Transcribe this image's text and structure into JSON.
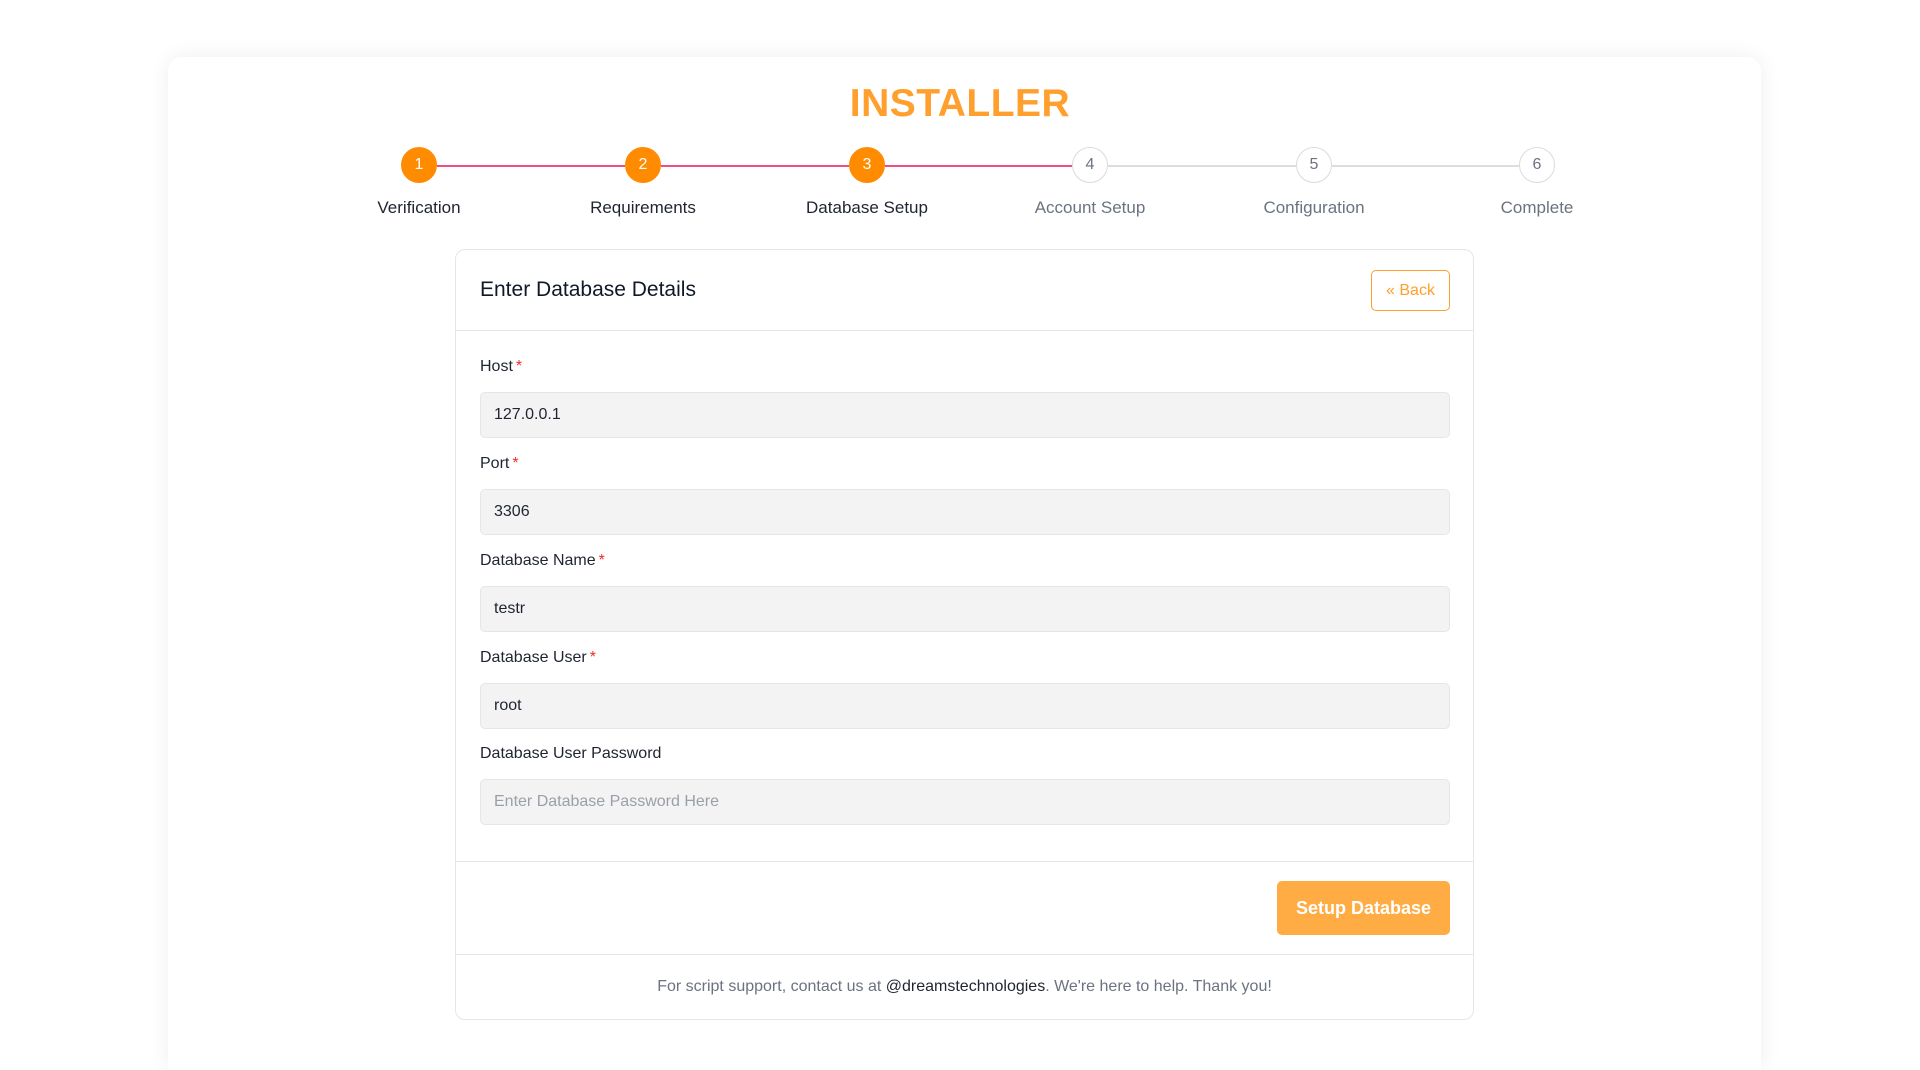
{
  "page": {
    "title": "INSTALLER"
  },
  "stepper": {
    "steps": [
      {
        "number": "1",
        "label": "Verification",
        "state": "done"
      },
      {
        "number": "2",
        "label": "Requirements",
        "state": "done"
      },
      {
        "number": "3",
        "label": "Database Setup",
        "state": "done"
      },
      {
        "number": "4",
        "label": "Account Setup",
        "state": "todo"
      },
      {
        "number": "5",
        "label": "Configuration",
        "state": "todo"
      },
      {
        "number": "6",
        "label": "Complete",
        "state": "todo"
      }
    ]
  },
  "form": {
    "title": "Enter Database Details",
    "back_label": "« Back",
    "required_mark": "*",
    "fields": {
      "host": {
        "label": "Host",
        "value": "127.0.0.1"
      },
      "port": {
        "label": "Port",
        "value": "3306"
      },
      "db_name": {
        "label": "Database Name",
        "value": "testr"
      },
      "db_user": {
        "label": "Database User",
        "value": "root"
      },
      "db_password": {
        "label": "Database User Password",
        "value": "",
        "placeholder": "Enter Database Password Here"
      }
    },
    "submit_label": "Setup Database"
  },
  "footer": {
    "prefix": "For script support, contact us at ",
    "handle": "@dreamstechnologies",
    "suffix": ". We're here to help. Thank you!"
  },
  "colors": {
    "accent": "#ff9f2d",
    "step_done": "#ff8c00",
    "progress_line": "#ef4f7f",
    "pending_line": "#dcdde1",
    "required": "#ef2b2b",
    "button": "#ffac44"
  }
}
